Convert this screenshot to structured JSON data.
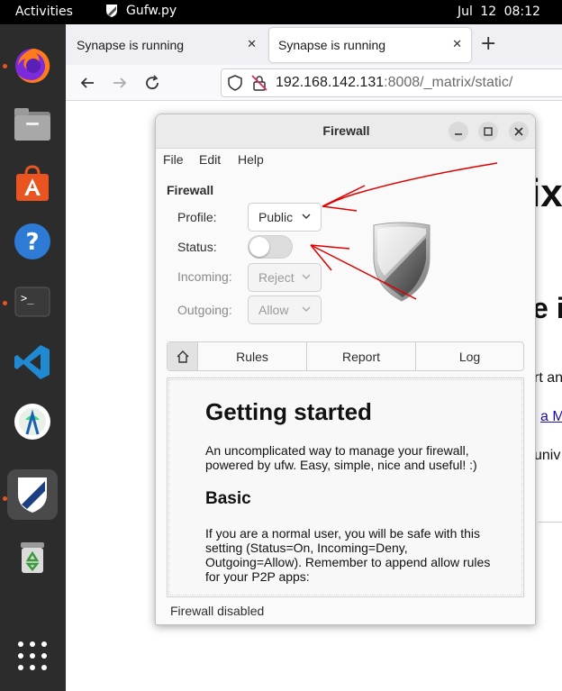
{
  "topbar": {
    "activities": "Activities",
    "app_name": "Gufw.py",
    "clock": "Jul 12  08:12"
  },
  "dock": {
    "items": [
      "firefox-icon",
      "files-icon",
      "app-center-icon",
      "help-icon",
      "terminal-icon",
      "vscode-icon",
      "android-studio-icon",
      "gufw-icon",
      "trash-icon",
      "show-apps-icon"
    ]
  },
  "browser": {
    "tabs": [
      {
        "label": "Synapse is running"
      },
      {
        "label": "Synapse is running"
      }
    ],
    "new_tab": "+",
    "url_host": "192.168.142.131",
    "url_path": ":8008/_matrix/static/",
    "page_fragments": [
      "ix",
      "e is",
      "rt an",
      "a M",
      "univ"
    ]
  },
  "gufw": {
    "title": "Firewall",
    "menu": [
      "File",
      "Edit",
      "Help"
    ],
    "heading": "Firewall",
    "profile_label": "Profile:",
    "profile_value": "Public",
    "status_label": "Status:",
    "status_on": false,
    "incoming_label": "Incoming:",
    "incoming_value": "Reject",
    "outgoing_label": "Outgoing:",
    "outgoing_value": "Allow",
    "tabs": [
      "Rules",
      "Report",
      "Log"
    ],
    "help": {
      "title": "Getting started",
      "intro": "An uncomplicated way to manage your firewall, powered by ufw. Easy, simple, nice and useful! :)",
      "basic_heading": "Basic",
      "basic_text": "If you are a normal user, you will be safe with this setting (Status=On, Incoming=Deny, Outgoing=Allow). Remember to append allow rules for your P2P apps:"
    },
    "statusbar": "Firewall disabled"
  },
  "colors": {
    "dock_bg": "#2c2c2c",
    "accent_dot": "#e95420",
    "annotation": "#e00000"
  }
}
